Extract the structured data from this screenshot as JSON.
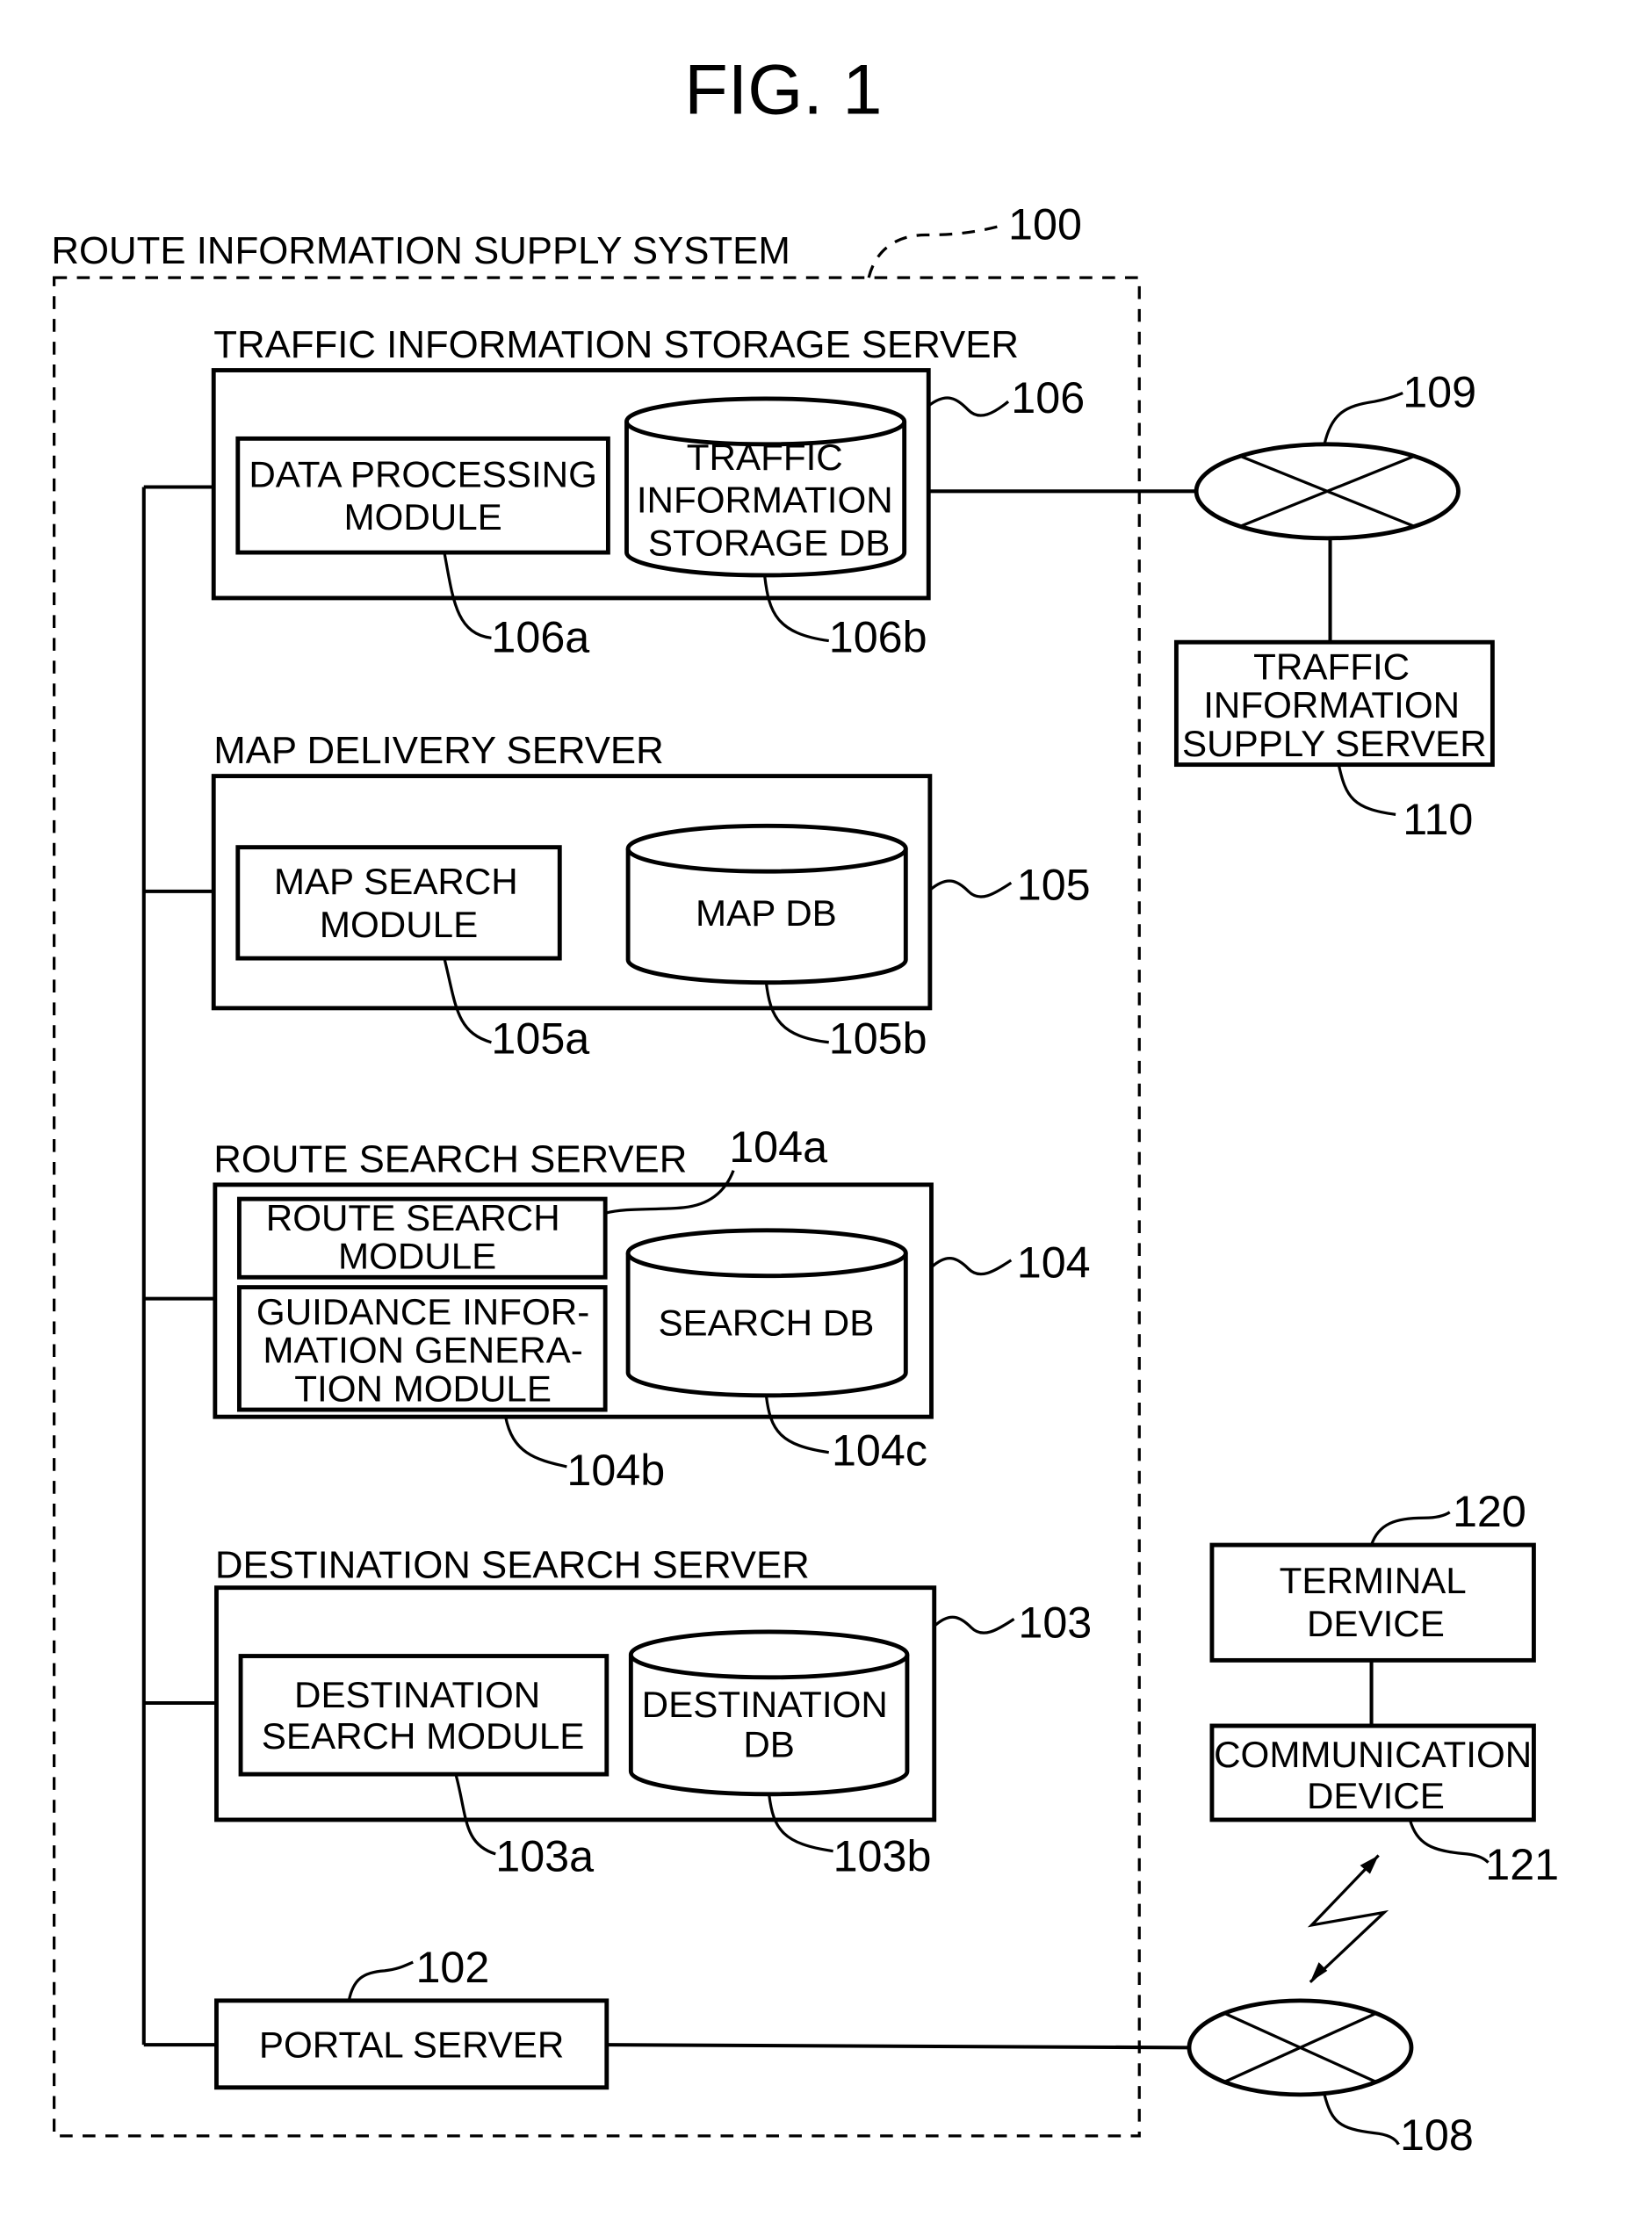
{
  "figure": {
    "title": "FIG. 1"
  },
  "system": {
    "label": "ROUTE INFORMATION SUPPLY SYSTEM",
    "ref": "100"
  },
  "servers": {
    "traffic_storage": {
      "label": "TRAFFIC INFORMATION STORAGE SERVER",
      "ref": "106",
      "module": {
        "lines": [
          "DATA PROCESSING",
          "MODULE"
        ],
        "ref": "106a"
      },
      "db": {
        "lines": [
          "TRAFFIC",
          "INFORMATION",
          "STORAGE DB"
        ],
        "ref": "106b"
      }
    },
    "map_delivery": {
      "label": "MAP DELIVERY SERVER",
      "ref": "105",
      "module": {
        "lines": [
          "MAP SEARCH",
          "MODULE"
        ],
        "ref": "105a"
      },
      "db": {
        "lines": [
          "MAP DB"
        ],
        "ref": "105b"
      }
    },
    "route_search": {
      "label": "ROUTE SEARCH SERVER",
      "ref": "104",
      "module_a": {
        "lines": [
          "ROUTE SEARCH",
          "MODULE"
        ],
        "ref": "104a"
      },
      "module_b": {
        "lines": [
          "GUIDANCE INFOR-",
          "MATION GENERA-",
          "TION MODULE"
        ],
        "ref": "104b"
      },
      "db": {
        "lines": [
          "SEARCH DB"
        ],
        "ref": "104c"
      }
    },
    "destination_search": {
      "label": "DESTINATION SEARCH SERVER",
      "ref": "103",
      "module": {
        "lines": [
          "DESTINATION",
          "SEARCH MODULE"
        ],
        "ref": "103a"
      },
      "db": {
        "lines": [
          "DESTINATION",
          "DB"
        ],
        "ref": "103b"
      }
    },
    "portal": {
      "label": "PORTAL SERVER",
      "ref": "102"
    }
  },
  "external": {
    "network_109": {
      "ref": "109"
    },
    "traffic_supply_server": {
      "lines": [
        "TRAFFIC",
        "INFORMATION",
        "SUPPLY SERVER"
      ],
      "ref": "110"
    },
    "network_108": {
      "ref": "108"
    },
    "terminal_device": {
      "lines": [
        "TERMINAL",
        "DEVICE"
      ],
      "ref": "120"
    },
    "communication_device": {
      "lines": [
        "COMMUNICATION",
        "DEVICE"
      ],
      "ref": "121"
    }
  }
}
